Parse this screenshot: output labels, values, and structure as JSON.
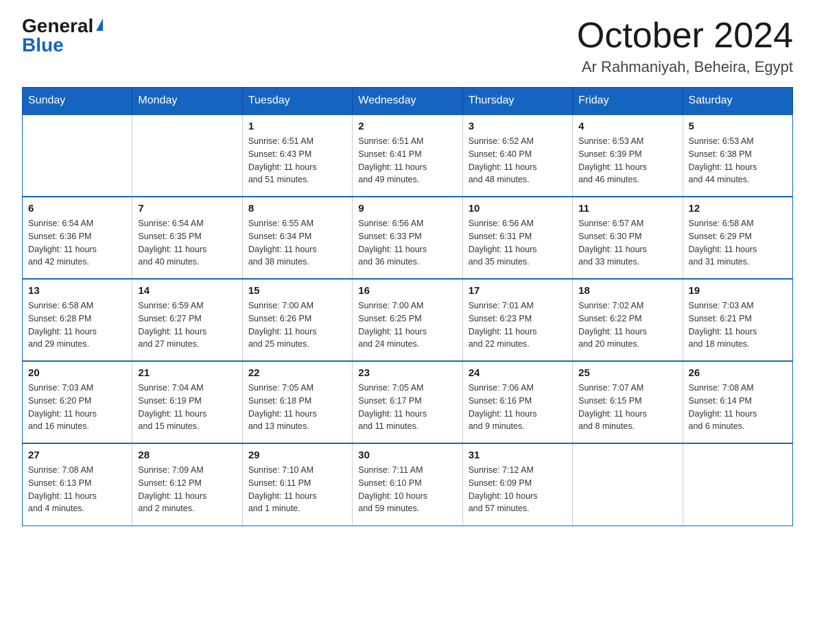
{
  "header": {
    "logo_general": "General",
    "logo_blue": "Blue",
    "month_title": "October 2024",
    "location": "Ar Rahmaniyah, Beheira, Egypt"
  },
  "days_of_week": [
    "Sunday",
    "Monday",
    "Tuesday",
    "Wednesday",
    "Thursday",
    "Friday",
    "Saturday"
  ],
  "weeks": [
    [
      {
        "day": "",
        "info": ""
      },
      {
        "day": "",
        "info": ""
      },
      {
        "day": "1",
        "info": "Sunrise: 6:51 AM\nSunset: 6:43 PM\nDaylight: 11 hours\nand 51 minutes."
      },
      {
        "day": "2",
        "info": "Sunrise: 6:51 AM\nSunset: 6:41 PM\nDaylight: 11 hours\nand 49 minutes."
      },
      {
        "day": "3",
        "info": "Sunrise: 6:52 AM\nSunset: 6:40 PM\nDaylight: 11 hours\nand 48 minutes."
      },
      {
        "day": "4",
        "info": "Sunrise: 6:53 AM\nSunset: 6:39 PM\nDaylight: 11 hours\nand 46 minutes."
      },
      {
        "day": "5",
        "info": "Sunrise: 6:53 AM\nSunset: 6:38 PM\nDaylight: 11 hours\nand 44 minutes."
      }
    ],
    [
      {
        "day": "6",
        "info": "Sunrise: 6:54 AM\nSunset: 6:36 PM\nDaylight: 11 hours\nand 42 minutes."
      },
      {
        "day": "7",
        "info": "Sunrise: 6:54 AM\nSunset: 6:35 PM\nDaylight: 11 hours\nand 40 minutes."
      },
      {
        "day": "8",
        "info": "Sunrise: 6:55 AM\nSunset: 6:34 PM\nDaylight: 11 hours\nand 38 minutes."
      },
      {
        "day": "9",
        "info": "Sunrise: 6:56 AM\nSunset: 6:33 PM\nDaylight: 11 hours\nand 36 minutes."
      },
      {
        "day": "10",
        "info": "Sunrise: 6:56 AM\nSunset: 6:31 PM\nDaylight: 11 hours\nand 35 minutes."
      },
      {
        "day": "11",
        "info": "Sunrise: 6:57 AM\nSunset: 6:30 PM\nDaylight: 11 hours\nand 33 minutes."
      },
      {
        "day": "12",
        "info": "Sunrise: 6:58 AM\nSunset: 6:29 PM\nDaylight: 11 hours\nand 31 minutes."
      }
    ],
    [
      {
        "day": "13",
        "info": "Sunrise: 6:58 AM\nSunset: 6:28 PM\nDaylight: 11 hours\nand 29 minutes."
      },
      {
        "day": "14",
        "info": "Sunrise: 6:59 AM\nSunset: 6:27 PM\nDaylight: 11 hours\nand 27 minutes."
      },
      {
        "day": "15",
        "info": "Sunrise: 7:00 AM\nSunset: 6:26 PM\nDaylight: 11 hours\nand 25 minutes."
      },
      {
        "day": "16",
        "info": "Sunrise: 7:00 AM\nSunset: 6:25 PM\nDaylight: 11 hours\nand 24 minutes."
      },
      {
        "day": "17",
        "info": "Sunrise: 7:01 AM\nSunset: 6:23 PM\nDaylight: 11 hours\nand 22 minutes."
      },
      {
        "day": "18",
        "info": "Sunrise: 7:02 AM\nSunset: 6:22 PM\nDaylight: 11 hours\nand 20 minutes."
      },
      {
        "day": "19",
        "info": "Sunrise: 7:03 AM\nSunset: 6:21 PM\nDaylight: 11 hours\nand 18 minutes."
      }
    ],
    [
      {
        "day": "20",
        "info": "Sunrise: 7:03 AM\nSunset: 6:20 PM\nDaylight: 11 hours\nand 16 minutes."
      },
      {
        "day": "21",
        "info": "Sunrise: 7:04 AM\nSunset: 6:19 PM\nDaylight: 11 hours\nand 15 minutes."
      },
      {
        "day": "22",
        "info": "Sunrise: 7:05 AM\nSunset: 6:18 PM\nDaylight: 11 hours\nand 13 minutes."
      },
      {
        "day": "23",
        "info": "Sunrise: 7:05 AM\nSunset: 6:17 PM\nDaylight: 11 hours\nand 11 minutes."
      },
      {
        "day": "24",
        "info": "Sunrise: 7:06 AM\nSunset: 6:16 PM\nDaylight: 11 hours\nand 9 minutes."
      },
      {
        "day": "25",
        "info": "Sunrise: 7:07 AM\nSunset: 6:15 PM\nDaylight: 11 hours\nand 8 minutes."
      },
      {
        "day": "26",
        "info": "Sunrise: 7:08 AM\nSunset: 6:14 PM\nDaylight: 11 hours\nand 6 minutes."
      }
    ],
    [
      {
        "day": "27",
        "info": "Sunrise: 7:08 AM\nSunset: 6:13 PM\nDaylight: 11 hours\nand 4 minutes."
      },
      {
        "day": "28",
        "info": "Sunrise: 7:09 AM\nSunset: 6:12 PM\nDaylight: 11 hours\nand 2 minutes."
      },
      {
        "day": "29",
        "info": "Sunrise: 7:10 AM\nSunset: 6:11 PM\nDaylight: 11 hours\nand 1 minute."
      },
      {
        "day": "30",
        "info": "Sunrise: 7:11 AM\nSunset: 6:10 PM\nDaylight: 10 hours\nand 59 minutes."
      },
      {
        "day": "31",
        "info": "Sunrise: 7:12 AM\nSunset: 6:09 PM\nDaylight: 10 hours\nand 57 minutes."
      },
      {
        "day": "",
        "info": ""
      },
      {
        "day": "",
        "info": ""
      }
    ]
  ]
}
